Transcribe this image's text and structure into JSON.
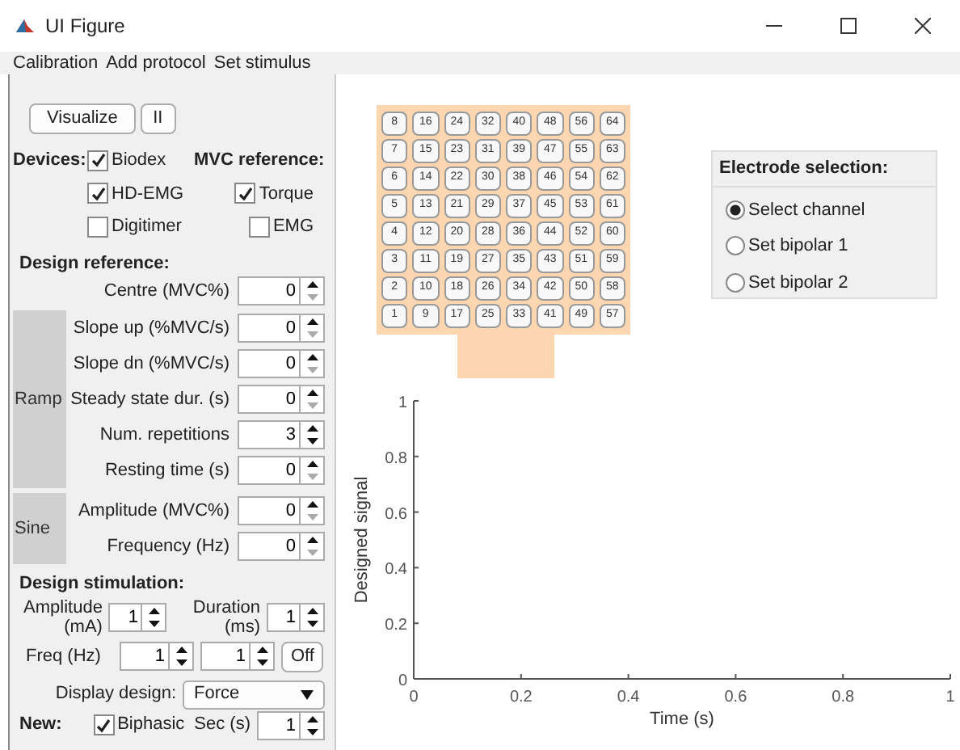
{
  "window": {
    "title": "UI Figure"
  },
  "menu": [
    "Calibration",
    "Add protocol",
    "Set stimulus"
  ],
  "toolbar_buttons": [
    "Visualize",
    "II"
  ],
  "devices": {
    "label": "Devices:",
    "items": [
      {
        "label": "Biodex",
        "checked": true
      },
      {
        "label": "HD-EMG",
        "checked": true
      },
      {
        "label": "Digitimer",
        "checked": false
      }
    ]
  },
  "mvc_reference": {
    "label": "MVC reference:",
    "items": [
      {
        "label": "Torque",
        "checked": true
      },
      {
        "label": "EMG",
        "checked": false
      }
    ]
  },
  "design_reference": {
    "title": "Design reference:",
    "fields": [
      {
        "label": "Centre (MVC%)",
        "value": "0",
        "at_minimum": true
      }
    ],
    "groups": [
      {
        "label": "Ramp",
        "fields": [
          {
            "label": "Slope up (%MVC/s)",
            "value": "0",
            "at_minimum": true
          },
          {
            "label": "Slope dn (%MVC/s)",
            "value": "0",
            "at_minimum": true
          },
          {
            "label": "Steady state dur. (s)",
            "value": "0",
            "at_minimum": true
          },
          {
            "label": "Num. repetitions",
            "value": "3",
            "at_minimum": false
          },
          {
            "label": "Resting time (s)",
            "value": "0",
            "at_minimum": true
          }
        ]
      },
      {
        "label": "Sine",
        "fields": [
          {
            "label": "Amplitude (MVC%)",
            "value": "0",
            "at_minimum": true
          },
          {
            "label": "Frequency (Hz)",
            "value": "0",
            "at_minimum": true
          }
        ]
      }
    ]
  },
  "design_stimulation": {
    "title": "Design stimulation:",
    "amplitude": {
      "label": "Amplitude (mA)",
      "value": "1",
      "at_minimum": false
    },
    "duration": {
      "label": "Duration (ms)",
      "value": "1",
      "at_minimum": false
    },
    "freq": {
      "label": "Freq (Hz)",
      "values": [
        "1",
        "1"
      ],
      "button": "Off"
    }
  },
  "display_design": {
    "label": "Display design:",
    "value": "Force"
  },
  "new": {
    "label": "New:",
    "biphasic": {
      "label": "Biphasic",
      "checked": true
    },
    "sec": {
      "label": "Sec (s)",
      "value": "1",
      "at_minimum": false
    }
  },
  "electrode_grid": [
    [
      "8",
      "16",
      "24",
      "32",
      "40",
      "48",
      "56",
      "64"
    ],
    [
      "7",
      "15",
      "23",
      "31",
      "39",
      "47",
      "55",
      "63"
    ],
    [
      "6",
      "14",
      "22",
      "30",
      "38",
      "46",
      "54",
      "62"
    ],
    [
      "5",
      "13",
      "21",
      "29",
      "37",
      "45",
      "53",
      "61"
    ],
    [
      "4",
      "12",
      "20",
      "28",
      "36",
      "44",
      "52",
      "60"
    ],
    [
      "3",
      "11",
      "19",
      "27",
      "35",
      "43",
      "51",
      "59"
    ],
    [
      "2",
      "10",
      "18",
      "26",
      "34",
      "42",
      "50",
      "58"
    ],
    [
      "1",
      "9",
      "17",
      "25",
      "33",
      "41",
      "49",
      "57"
    ]
  ],
  "electrode_selection": {
    "title": "Electrode selection:",
    "options": [
      {
        "label": "Select channel",
        "selected": true
      },
      {
        "label": "Set bipolar 1",
        "selected": false
      },
      {
        "label": "Set bipolar 2",
        "selected": false
      }
    ]
  },
  "plot": {
    "chart_data": {
      "type": "line",
      "xlabel": "Time (s)",
      "ylabel": "Designed signal",
      "xlim": [
        0,
        1
      ],
      "ylim": [
        0,
        1
      ],
      "xticks": [
        0,
        0.2,
        0.4,
        0.6,
        0.8,
        1
      ],
      "yticks": [
        0,
        0.2,
        0.4,
        0.6,
        0.8,
        1
      ]
    }
  }
}
